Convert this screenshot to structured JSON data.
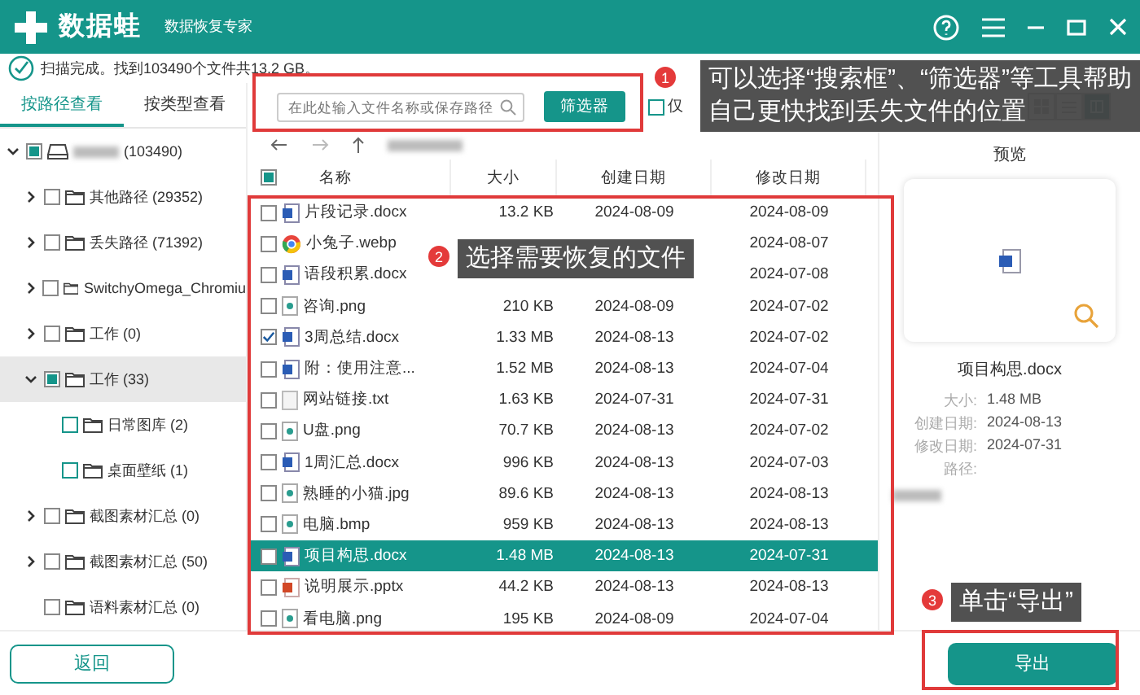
{
  "app": {
    "name": "数据蛙",
    "subtitle": "数据恢复专家"
  },
  "status": "扫描完成。找到103490个文件共13.2 GB。",
  "view_tabs": [
    {
      "label": "按路径查看",
      "selected": true
    },
    {
      "label": "按类型查看",
      "selected": false
    }
  ],
  "tree": [
    {
      "label": "(103490)",
      "kind": "drive",
      "checked": false,
      "partial": true,
      "expanded": true,
      "selected": false,
      "children": [
        {
          "label": "其他路径 (29352)",
          "kind": "folder",
          "checked": false,
          "partial": false,
          "expanded": false,
          "selected": false
        },
        {
          "label": "丢失路径 (71392)",
          "kind": "folder",
          "checked": false,
          "partial": false,
          "expanded": false,
          "selected": false
        },
        {
          "label": "SwitchyOmega_Chromiu",
          "kind": "folder",
          "checked": false,
          "partial": false,
          "expanded": false,
          "selected": false
        },
        {
          "label": "工作 (0)",
          "kind": "folder",
          "checked": false,
          "partial": false,
          "expanded": false,
          "selected": false
        },
        {
          "label": "工作 (33)",
          "kind": "folder",
          "checked": false,
          "partial": true,
          "expanded": true,
          "selected": true,
          "children": [
            {
              "label": "日常图库 (2)",
              "kind": "folder",
              "checked": false,
              "partial": false,
              "selected": false
            },
            {
              "label": "桌面壁纸 (1)",
              "kind": "folder",
              "checked": false,
              "partial": false,
              "selected": false
            }
          ]
        },
        {
          "label": "截图素材汇总 (0)",
          "kind": "folder",
          "checked": false,
          "partial": false,
          "expanded": false,
          "selected": false
        },
        {
          "label": "截图素材汇总 (50)",
          "kind": "folder",
          "checked": false,
          "partial": false,
          "expanded": false,
          "selected": false
        },
        {
          "label": "语料素材汇总 (0)",
          "kind": "folder",
          "checked": false,
          "partial": false,
          "selected": false
        }
      ]
    }
  ],
  "search": {
    "placeholder": "在此处输入文件名称或保存路径"
  },
  "filter_button": "筛选器",
  "only_checkbox": {
    "label": "仅",
    "checked": false
  },
  "columns": [
    "名称",
    "大小",
    "创建日期",
    "修改日期"
  ],
  "header_partial": true,
  "files": [
    {
      "name": "片段记录.docx",
      "kind": "doc",
      "size": "13.2 KB",
      "created": "2024-08-09",
      "modified": "2024-08-09",
      "checked": false,
      "selected": false
    },
    {
      "name": "小兔子.webp",
      "kind": "web",
      "modified": "2024-08-07",
      "checked": false,
      "selected": false
    },
    {
      "name": "语段积累.docx",
      "kind": "doc",
      "modified": "2024-07-08",
      "checked": false,
      "selected": false
    },
    {
      "name": "咨询.png",
      "kind": "image",
      "size": "210 KB",
      "created": "2024-08-09",
      "modified": "2024-07-02",
      "checked": false,
      "selected": false
    },
    {
      "name": "3周总结.docx",
      "kind": "doc",
      "size": "1.33 MB",
      "created": "2024-08-13",
      "modified": "2024-07-02",
      "checked": true,
      "selected": false
    },
    {
      "name": "附：使用注意...",
      "kind": "doc",
      "size": "1.52 MB",
      "created": "2024-08-13",
      "modified": "2024-07-04",
      "checked": false,
      "selected": false
    },
    {
      "name": "网站链接.txt",
      "kind": "text",
      "size": "1.63 KB",
      "created": "2024-07-31",
      "modified": "2024-07-31",
      "checked": false,
      "selected": false
    },
    {
      "name": "U盘.png",
      "kind": "image",
      "size": "70.7 KB",
      "created": "2024-08-13",
      "modified": "2024-07-02",
      "checked": false,
      "selected": false
    },
    {
      "name": "1周汇总.docx",
      "kind": "doc",
      "size": "996 KB",
      "created": "2024-08-13",
      "modified": "2024-07-03",
      "checked": false,
      "selected": false
    },
    {
      "name": "熟睡的小猫.jpg",
      "kind": "image",
      "size": "89.6 KB",
      "created": "2024-08-13",
      "modified": "2024-08-13",
      "checked": false,
      "selected": false
    },
    {
      "name": "电脑.bmp",
      "kind": "image",
      "size": "959 KB",
      "created": "2024-08-13",
      "modified": "2024-08-13",
      "checked": false,
      "selected": false
    },
    {
      "name": "项目构思.docx",
      "kind": "doc",
      "size": "1.48 MB",
      "created": "2024-08-13",
      "modified": "2024-07-31",
      "checked": false,
      "selected": true
    },
    {
      "name": "说明展示.pptx",
      "kind": "slides",
      "size": "44.2 KB",
      "created": "2024-08-13",
      "modified": "2024-08-13",
      "checked": false,
      "selected": false
    },
    {
      "name": "看电脑.png",
      "kind": "image",
      "size": "195 KB",
      "created": "2024-08-09",
      "modified": "2024-07-04",
      "checked": false,
      "selected": false
    }
  ],
  "preview": {
    "title": "预览",
    "file_name": "项目构思.docx",
    "details": [
      {
        "label": "大小:",
        "value": "1.48 MB"
      },
      {
        "label": "创建日期:",
        "value": "2024-08-13"
      },
      {
        "label": "修改日期:",
        "value": "2024-07-31"
      },
      {
        "label": "路径:"
      }
    ]
  },
  "back_button": "返回",
  "export_button": "导出",
  "tips": [
    {
      "number": "1",
      "text": "可以选择“搜索框”、“筛选器”等工具帮助自己更快找到丢失文件的位置"
    },
    {
      "number": "2",
      "text": "选择需要恢复的文件"
    },
    {
      "number": "3",
      "text": "单击“导出”"
    }
  ]
}
